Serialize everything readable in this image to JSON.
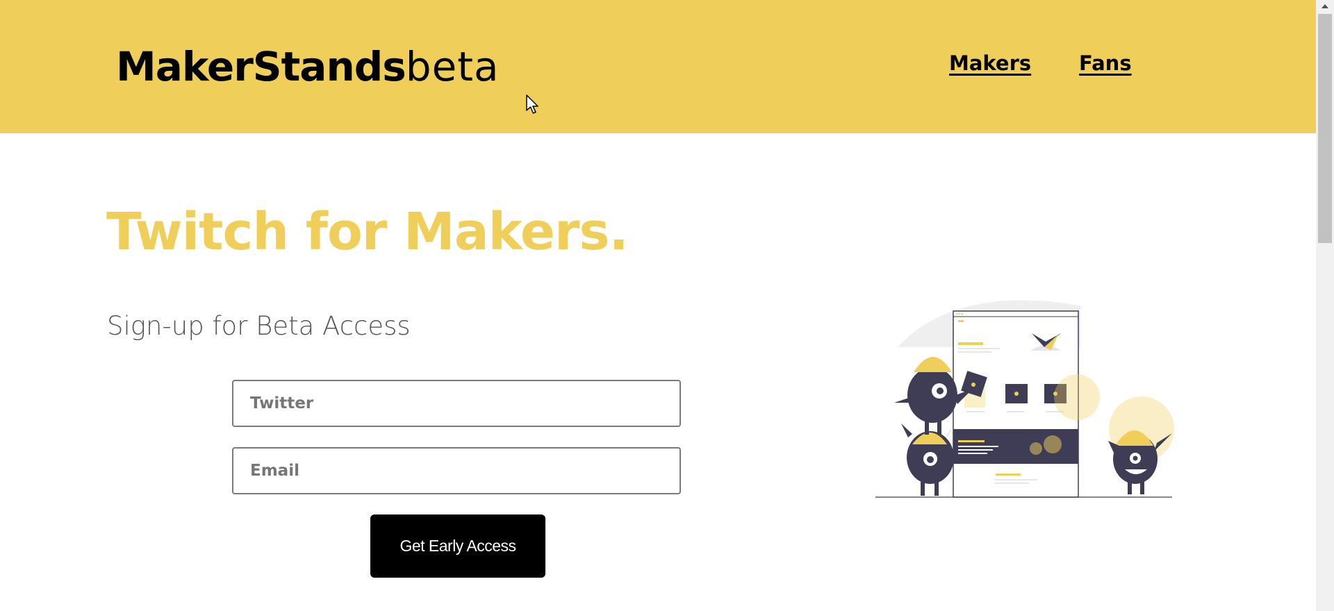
{
  "header": {
    "logo_brand": "MakerStands",
    "logo_tag": "beta",
    "nav": {
      "makers": "Makers",
      "fans": "Fans"
    }
  },
  "hero": {
    "headline": "Twitch for Makers.",
    "subhead": "Sign-up for Beta Access"
  },
  "form": {
    "twitter_placeholder": "Twitter",
    "email_placeholder": "Email",
    "submit_label": "Get Early Access"
  },
  "colors": {
    "accent": "#efcf5a",
    "dark": "#3f3d56",
    "button": "#000000"
  },
  "icons": {
    "cursor": "mouse-pointer-icon",
    "scroll_up": "scroll-up-arrow-icon"
  }
}
